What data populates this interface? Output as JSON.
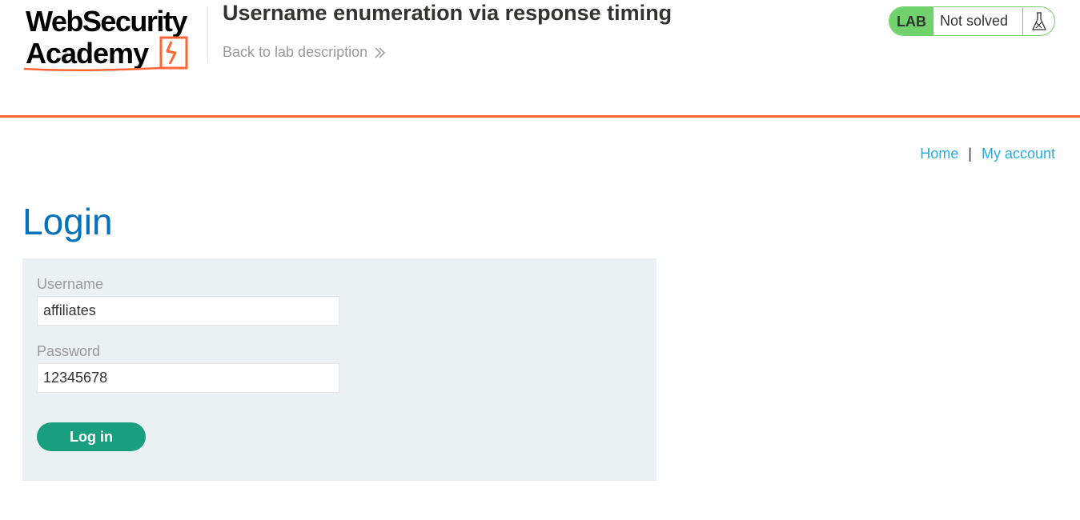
{
  "header": {
    "logo_text": "Web Security Academy",
    "lab_title": "Username enumeration via response timing",
    "back_link": "Back to lab description"
  },
  "status": {
    "badge": "LAB",
    "text": "Not solved",
    "icon": "flask-icon"
  },
  "nav": {
    "home": "Home",
    "separator": "|",
    "my_account": "My account"
  },
  "page": {
    "title": "Login"
  },
  "form": {
    "username_label": "Username",
    "username_value": "affiliates",
    "password_label": "Password",
    "password_value": "12345678",
    "submit_label": "Log in"
  },
  "colors": {
    "accent_orange": "#ff6633",
    "title_blue": "#0071bc",
    "link_blue": "#29abe2",
    "lab_green": "#70d16d",
    "button_green": "#1a9e80",
    "panel_bg": "#ebf0f2"
  }
}
